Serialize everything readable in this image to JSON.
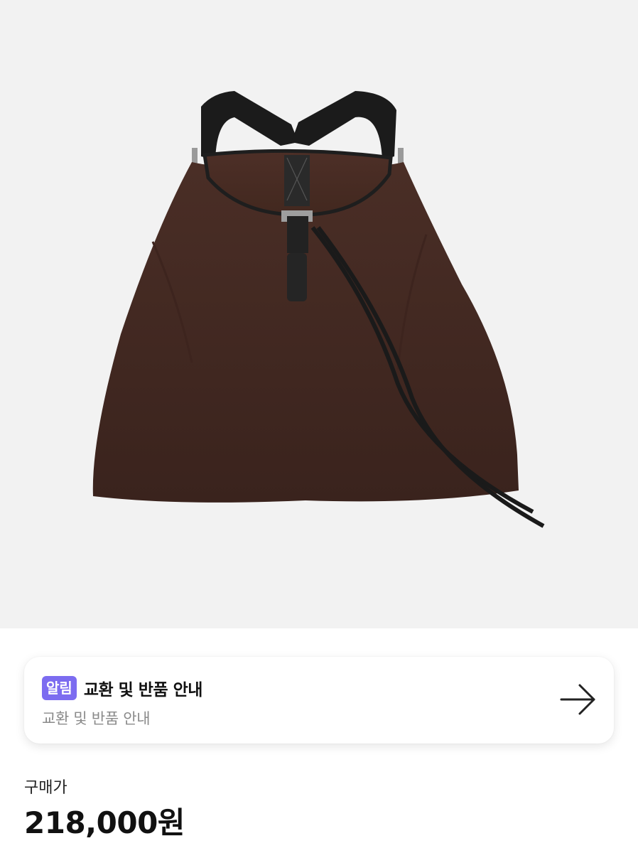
{
  "product": {
    "image_alt": "brown nylon drawstring backpack"
  },
  "notice": {
    "badge": "알림",
    "title": "교환 및 반품 안내",
    "subtitle": "교환 및 반품 안내",
    "arrow_icon": "arrow-right-icon",
    "badge_color": "#7c6cf0"
  },
  "price": {
    "label": "구매가",
    "value": "218,000원"
  }
}
